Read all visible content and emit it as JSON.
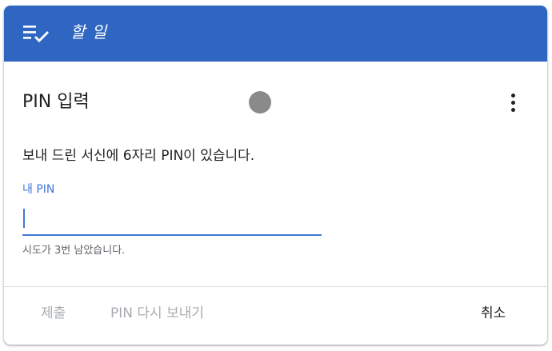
{
  "appbar": {
    "icon": "task-list-check-icon",
    "title": "할 일",
    "color": "#2f66c2"
  },
  "header": {
    "title": "PIN 입력",
    "menu_icon": "more-vert-icon"
  },
  "body": {
    "instructions": "보내 드린 서신에 6자리 PIN이 있습니다.",
    "field_label": "내 PIN",
    "field_value": "",
    "helper_text": "시도가 3번 남았습니다."
  },
  "actions": {
    "submit_label": "제출",
    "resend_label": "PIN 다시 보내기",
    "cancel_label": "취소"
  },
  "colors": {
    "accent": "#3f78d8",
    "disabled_text": "#a8acb0"
  }
}
